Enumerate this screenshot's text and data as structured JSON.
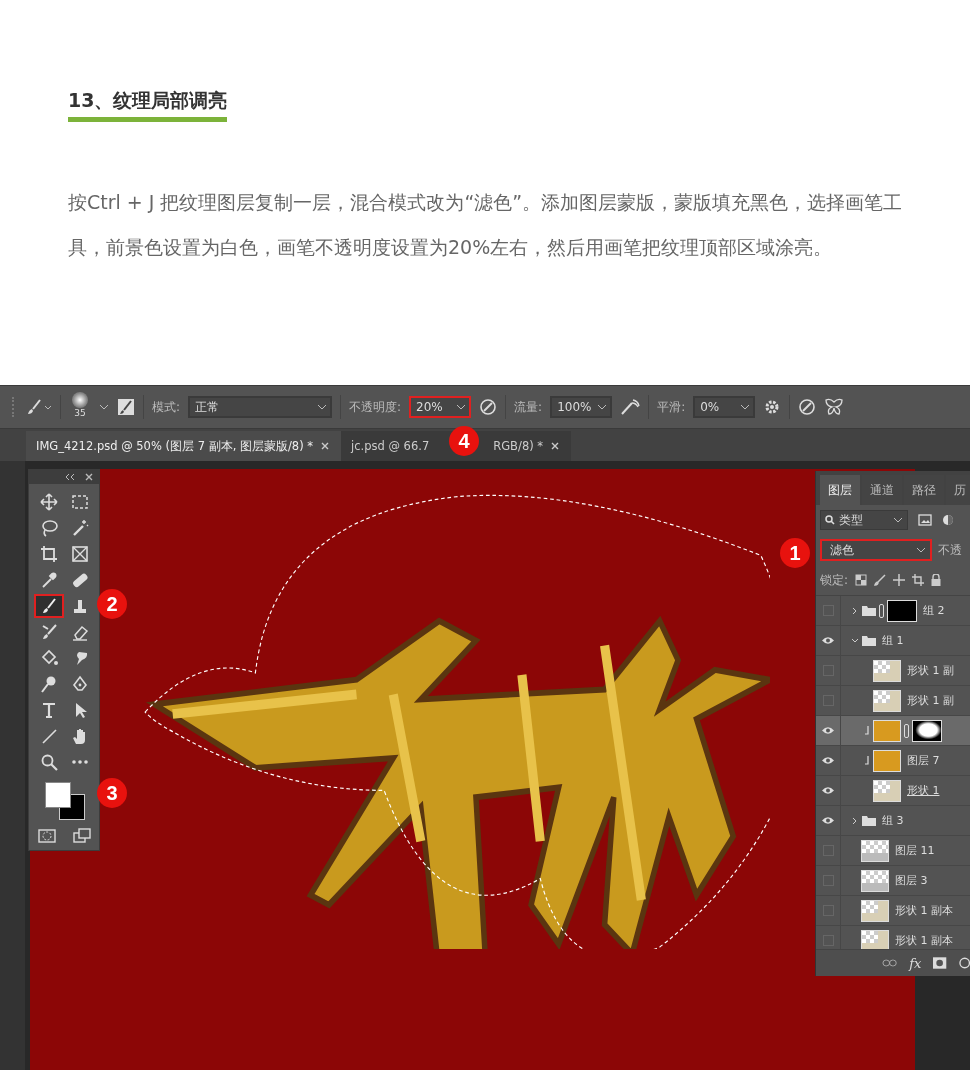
{
  "article": {
    "heading": "13、纹理局部调亮",
    "paragraph": "按Ctrl + J 把纹理图层复制一层，混合模式改为“滤色”。添加图层蒙版，蒙版填充黑色，选择画笔工具，前景色设置为白色，画笔不透明度设置为20%左右，然后用画笔把纹理顶部区域涂亮。"
  },
  "options_bar": {
    "brush_size": "35",
    "mode": {
      "label": "模式:",
      "value": "正常"
    },
    "opacity": {
      "label": "不透明度:",
      "value": "20%",
      "highlighted": true,
      "badge": "4"
    },
    "flow": {
      "label": "流量:",
      "value": "100%"
    },
    "smoothing": {
      "label": "平滑:",
      "value": "0%"
    }
  },
  "document_tabs": [
    {
      "title": "IMG_4212.psd @ 50% (图层 7 副本, 图层蒙版/8) *",
      "selected": true
    },
    {
      "title": "jc.psd @ 66.7",
      "title_end": "RGB/8) *",
      "selected": false
    }
  ],
  "tools": [
    {
      "kind": "move",
      "selected": false
    },
    {
      "kind": "marquee",
      "selected": false
    },
    {
      "kind": "lasso",
      "selected": false
    },
    {
      "kind": "wand",
      "selected": false
    },
    {
      "kind": "crop",
      "selected": false
    },
    {
      "kind": "frame",
      "selected": false
    },
    {
      "kind": "eyedropper",
      "selected": false
    },
    {
      "kind": "healing",
      "selected": false
    },
    {
      "kind": "brush",
      "selected": true,
      "highlighted": true,
      "badge": "2"
    },
    {
      "kind": "stamp",
      "selected": false
    },
    {
      "kind": "historybrush",
      "selected": false
    },
    {
      "kind": "eraser",
      "selected": false
    },
    {
      "kind": "bucket",
      "selected": false
    },
    {
      "kind": "smudge",
      "selected": false
    },
    {
      "kind": "dodge",
      "selected": false
    },
    {
      "kind": "pen",
      "selected": false
    },
    {
      "kind": "type",
      "selected": false
    },
    {
      "kind": "pointer",
      "selected": false
    },
    {
      "kind": "line",
      "selected": false
    },
    {
      "kind": "hand",
      "selected": false
    },
    {
      "kind": "zoom",
      "selected": false
    },
    {
      "kind": "more",
      "selected": false
    }
  ],
  "swatches": {
    "badge": "3"
  },
  "layers_panel": {
    "tabs": [
      {
        "label": "图层",
        "selected": true
      },
      {
        "label": "通道",
        "selected": false
      },
      {
        "label": "路径",
        "selected": false
      },
      {
        "label": "历",
        "selected": false
      }
    ],
    "filter": "类型",
    "blend_mode": {
      "value": "滤色",
      "highlighted": true,
      "badge": "1"
    },
    "opacity_label": "不透",
    "lock_label": "锁定:",
    "layers": [
      {
        "kind": "group",
        "name": "组 2",
        "visible": false,
        "expanded": false,
        "mask": true
      },
      {
        "kind": "group",
        "name": "组 1",
        "visible": true,
        "expanded": true,
        "mask": false,
        "children": [
          {
            "kind": "shape",
            "name": "形状 1 副",
            "visible": false,
            "selected": false,
            "clipped": false,
            "mask": false
          },
          {
            "kind": "shape",
            "name": "形状 1 副",
            "visible": false,
            "selected": false,
            "clipped": false,
            "mask": false
          },
          {
            "kind": "texture",
            "visible": true,
            "selected": true,
            "clipped": true,
            "mask": true
          },
          {
            "kind": "texture",
            "name": "图层 7",
            "visible": true,
            "selected": false,
            "clipped": true,
            "mask": false
          },
          {
            "kind": "shape",
            "name": "形状 1",
            "visible": true,
            "selected": false,
            "clipped": false,
            "mask": false,
            "clip_base": true
          }
        ]
      },
      {
        "kind": "group",
        "name": "组 3",
        "visible": true,
        "expanded": false,
        "mask": false
      },
      {
        "kind": "pixel",
        "name": "图层 11",
        "visible": false,
        "selected": false,
        "clipped": false,
        "mask": false
      },
      {
        "kind": "pixel",
        "name": "图层 3",
        "visible": false,
        "selected": false,
        "clipped": false,
        "mask": false
      },
      {
        "kind": "shape",
        "name": "形状 1 副本",
        "visible": false,
        "selected": false,
        "clipped": false,
        "mask": false
      },
      {
        "kind": "shape",
        "name": "形状 1 副本",
        "visible": false,
        "selected": false,
        "clipped": false,
        "mask": false
      }
    ],
    "footer_fx": "fx"
  }
}
